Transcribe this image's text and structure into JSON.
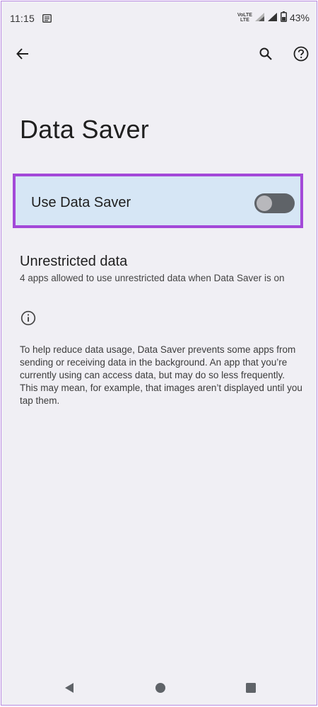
{
  "status_bar": {
    "time": "11:15",
    "network_badge_top": "VoLTE",
    "network_badge_bottom": "LTE",
    "battery_percent": "43%",
    "icons": [
      "notification-icon",
      "lte-icon",
      "signal-icon",
      "battery-icon"
    ]
  },
  "app_bar": {
    "back_icon": "arrow-back-icon",
    "search_icon": "search-icon",
    "help_icon": "help-icon"
  },
  "page": {
    "title": "Data Saver"
  },
  "main_switch": {
    "label": "Use Data Saver",
    "enabled": false,
    "highlight_color": "#a349d8",
    "background_color": "#d6e6f5"
  },
  "unrestricted": {
    "title": "Unrestricted data",
    "summary": "4 apps allowed to use unrestricted data when Data Saver is on"
  },
  "footer": {
    "icon": "info-icon",
    "text": "To help reduce data usage, Data Saver prevents some apps from sending or receiving data in the background. An app that you’re currently using can access data, but may do so less frequently. This may mean, for example, that images aren’t displayed until you tap them."
  },
  "nav_bar": {
    "buttons": [
      "back-triangle-icon",
      "home-circle-icon",
      "recents-square-icon"
    ]
  }
}
